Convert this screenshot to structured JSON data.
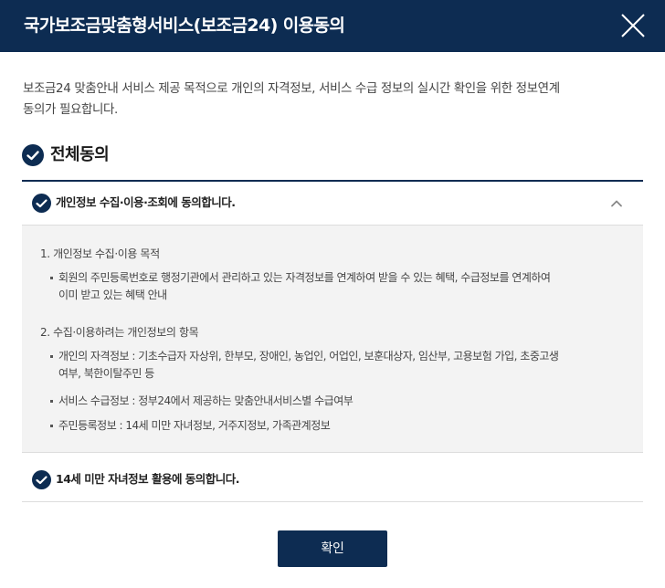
{
  "header": {
    "title": "국가보조금맞춤형서비스(보조금24) 이용동의",
    "close_icon": "close-icon"
  },
  "intro": {
    "line1": "보조금24 맞춤안내 서비스 제공 목적으로 개인의 자격정보, 서비스 수급 정보의 실시간 확인을 위한 정보연계",
    "line2": "동의가 필요합니다."
  },
  "all_agree": {
    "label": "전체동의",
    "checked": true
  },
  "items": [
    {
      "label": "개인정보 수집·이용·조회에 동의합니다.",
      "checked": true,
      "expanded": true
    },
    {
      "label": "14세 미만 자녀정보 활용에 동의합니다.",
      "checked": true,
      "expanded": false
    }
  ],
  "detail": {
    "section1": {
      "title": "1. 개인정보 수집·이용 목적",
      "bullet1_line1": "회원의 주민등록번호로 행정기관에서 관리하고 있는 자격정보를 연계하여 받을 수 있는 혜택, 수급정보를 연계하여",
      "bullet1_line2": "이미 받고 있는 혜택 안내"
    },
    "section2": {
      "title": "2. 수집·이용하려는 개인정보의 항목",
      "bullet1_line1": "개인의 자격정보 : 기초수급자 자상위, 한부모, 장애인, 농업인, 어업인, 보훈대상자, 임산부, 고용보험 가입, 초중고생",
      "bullet1_line2": "여부, 북한이탈주민 등",
      "bullet2": "서비스 수급정보 : 정부24에서 제공하는 맞춤안내서비스별 수급여부",
      "bullet3": "주민등록정보 : 14세 미만 자녀정보, 거주지정보, 가족관계정보"
    }
  },
  "footer": {
    "confirm_label": "확인"
  },
  "colors": {
    "primary": "#0d2c52",
    "panel_bg": "#f3f3f3",
    "divider": "#dddddd"
  }
}
